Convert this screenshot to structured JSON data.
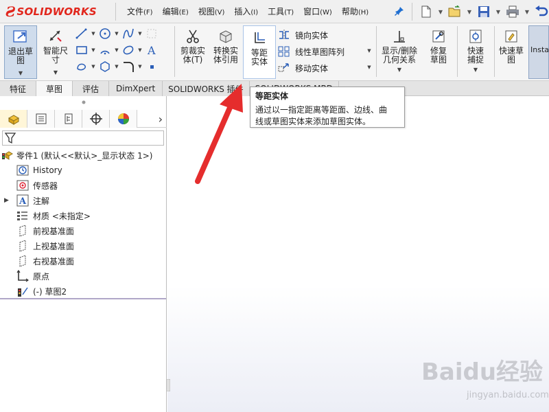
{
  "app": {
    "brand": "SOLIDWORKS",
    "logo_icon": "ds-logo"
  },
  "menu": [
    {
      "label": "文件",
      "key": "(F)"
    },
    {
      "label": "编辑",
      "key": "(E)"
    },
    {
      "label": "视图",
      "key": "(V)"
    },
    {
      "label": "插入",
      "key": "(I)"
    },
    {
      "label": "工具",
      "key": "(T)"
    },
    {
      "label": "窗口",
      "key": "(W)"
    },
    {
      "label": "帮助",
      "key": "(H)"
    }
  ],
  "ribbon": {
    "exit_sketch": "退出草图",
    "smart_dim": "智能尺寸",
    "trim": "剪裁实体(T)",
    "convert": "转换实体引用",
    "offset": "等距实体",
    "mirror": "镜向实体",
    "linear_pattern": "线性草图阵列",
    "move": "移动实体",
    "display_relations": "显示/删除几何关系",
    "repair": "修复草图",
    "quick_snaps": "快速捕捉",
    "rapid_sketch": "快速草图",
    "instant": "Insta"
  },
  "tabs": [
    {
      "label": "特征",
      "active": false
    },
    {
      "label": "草图",
      "active": true
    },
    {
      "label": "评估",
      "active": false
    },
    {
      "label": "DimXpert",
      "active": false
    },
    {
      "label": "SOLIDWORKS 插件",
      "active": false
    },
    {
      "label": "SOLIDWORKS MBD",
      "active": false
    }
  ],
  "tooltip": {
    "title": "等距实体",
    "line1": "通过以一指定距离等距面、边线、曲",
    "line2": "线或草图实体来添加草图实体。"
  },
  "tree": {
    "root": "零件1 (默认<<默认>_显示状态 1>)",
    "items": [
      {
        "label": "History",
        "icon": "history-icon"
      },
      {
        "label": "传感器",
        "icon": "sensor-icon"
      },
      {
        "label": "注解",
        "icon": "annotation-icon"
      },
      {
        "label": "材质 <未指定>",
        "icon": "material-icon"
      },
      {
        "label": "前视基准面",
        "icon": "plane-icon"
      },
      {
        "label": "上视基准面",
        "icon": "plane-icon"
      },
      {
        "label": "右视基准面",
        "icon": "plane-icon"
      },
      {
        "label": "原点",
        "icon": "origin-icon"
      },
      {
        "label": "(-) 草图2",
        "icon": "sketch-icon"
      }
    ]
  },
  "watermark": {
    "main": "Baidu经验",
    "sub": "jingyan.baidu.com"
  },
  "colors": {
    "brand_red": "#e1261c",
    "arrow_red": "#e52d2d",
    "tab_bg": "#e4e4e4"
  }
}
